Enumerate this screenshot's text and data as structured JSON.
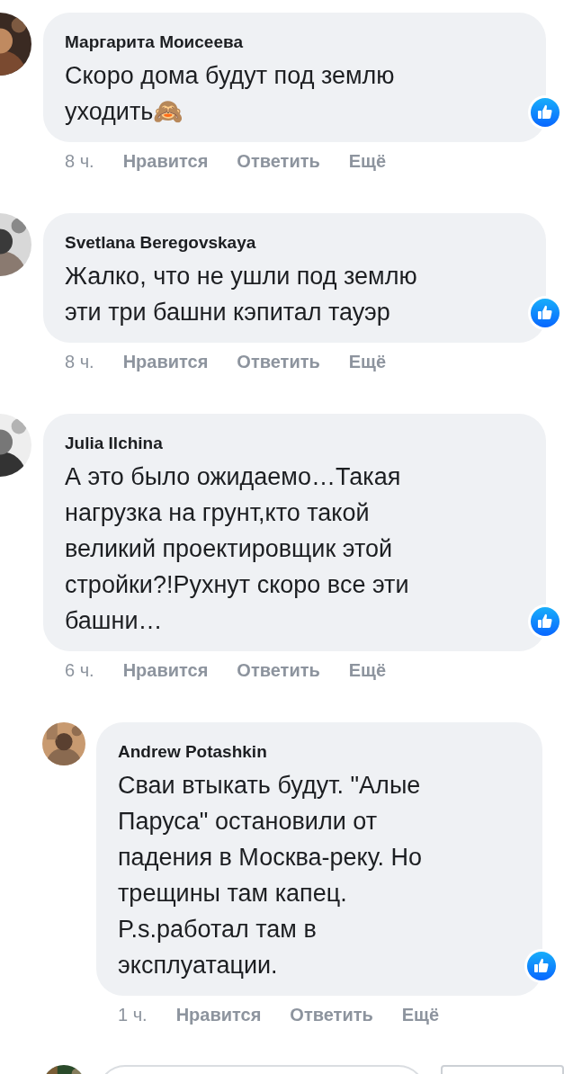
{
  "comments": [
    {
      "author": "Маргарита Моисеева",
      "text": "Скоро дома будут под землю\nуходить🙈",
      "time": "8 ч.",
      "actions": [
        "Нравится",
        "Ответить",
        "Ещё"
      ],
      "liked": true,
      "reply": false
    },
    {
      "author": "Svetlana Beregovskaya",
      "text": "Жалко, что не ушли под землю\nэти три башни кэпитал тауэр",
      "time": "8 ч.",
      "actions": [
        "Нравится",
        "Ответить",
        "Ещё"
      ],
      "liked": true,
      "reply": false
    },
    {
      "author": "Julia Ilchina",
      "text": "А это было ожидаемо…Такая\nнагрузка на грунт,кто такой\nвеликий проектировщик этой\nстройки?!Рухнут скоро все эти\nбашни…",
      "time": "6 ч.",
      "actions": [
        "Нравится",
        "Ответить",
        "Ещё"
      ],
      "liked": true,
      "reply": false
    },
    {
      "author": "Andrew Potashkin",
      "text": "Сваи втыкать будут. \"Алые\nПаруса\" остановили от\nпадения в Москва-реку. Но\nтрещины там капец.\nP.s.работал там в\nэксплуатации.",
      "time": "1 ч.",
      "actions": [
        "Нравится",
        "Ответить",
        "Ещё"
      ],
      "liked": true,
      "reply": true
    }
  ]
}
